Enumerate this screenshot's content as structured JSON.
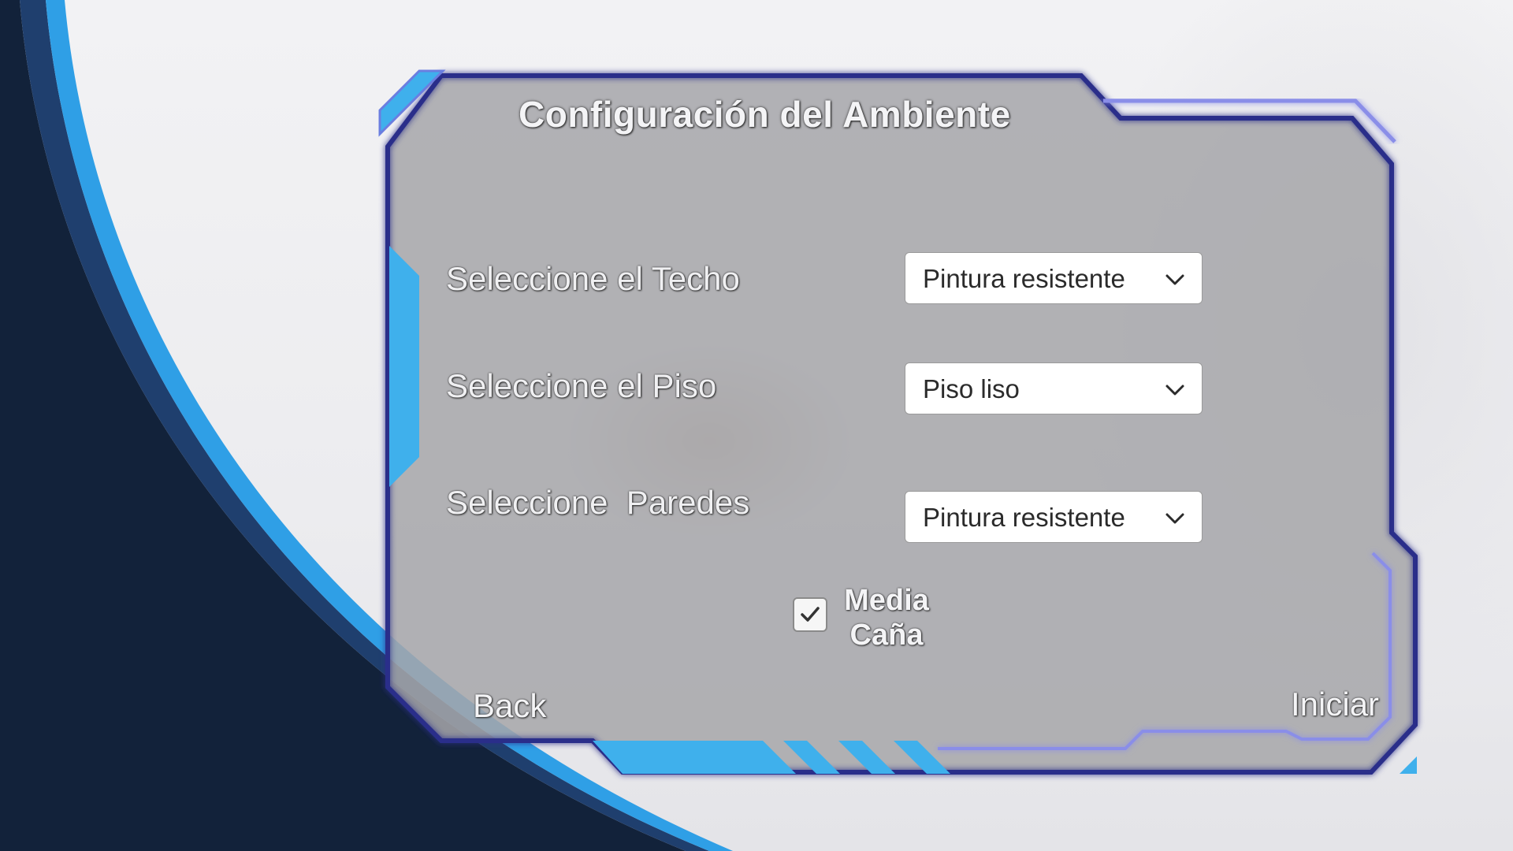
{
  "title": "Configuración del Ambiente",
  "rows": [
    {
      "label": "Seleccione el Techo",
      "selected": "Pintura resistente"
    },
    {
      "label": "Seleccione el Piso",
      "selected": "Piso liso"
    },
    {
      "label": "Seleccione  Paredes",
      "selected": "Pintura resistente"
    }
  ],
  "checkbox": {
    "label": "Media\nCaña",
    "checked": true
  },
  "buttons": {
    "back": "Back",
    "start": "Iniciar"
  },
  "icons": {
    "dropdown": "chevron-down-icon",
    "check": "checkmark-icon"
  },
  "colors": {
    "accent_blue": "#3fb0ec",
    "frame_navy": "#2a2f8a",
    "panel_fill": "#a8a8ac",
    "background_dark": "#12223a"
  }
}
